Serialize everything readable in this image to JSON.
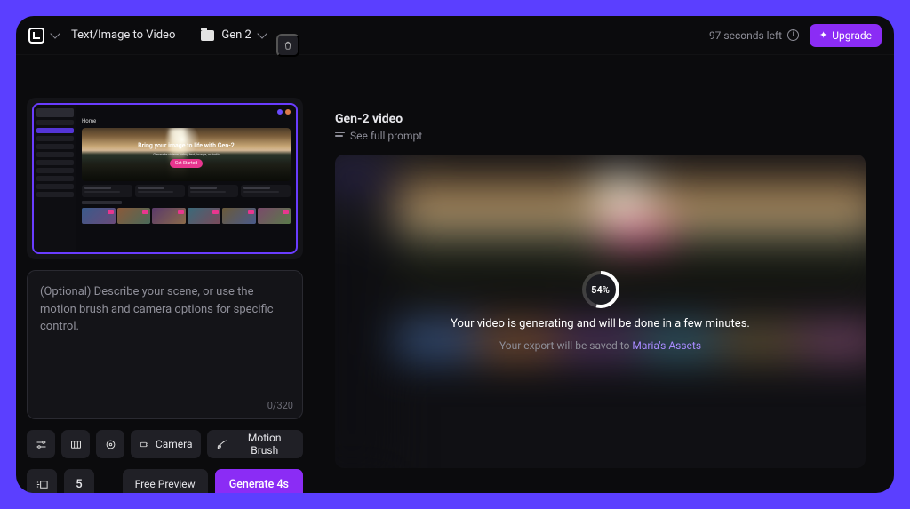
{
  "topbar": {
    "mode_label": "Text/Image to Video",
    "project_name": "Gen 2",
    "seconds_left": "97 seconds left",
    "upgrade_label": "Upgrade"
  },
  "thumbnail": {
    "home_label": "Home",
    "banner_headline": "Bring your image to life with Gen-2",
    "banner_sub": "Generate videos using text, image, or both",
    "cta": "Get Started",
    "chips": [
      "Your tools",
      "Try Gen 1",
      "Try Training",
      "Tell us about yourself"
    ],
    "section_title": "Popular AI Magic Tools"
  },
  "prompt": {
    "placeholder": "(Optional) Describe your scene, or use the motion brush and camera options for specific control.",
    "char_count": "0/320"
  },
  "tools": {
    "camera_label": "Camera",
    "motion_brush_label": "Motion Brush"
  },
  "bottom": {
    "number_value": "5",
    "free_preview_label": "Free Preview",
    "generate_label": "Generate 4s"
  },
  "content": {
    "title": "Gen-2 video",
    "see_prompt_label": "See full prompt",
    "progress_pct": "54%",
    "generating_msg": "Your video is generating and will be done in a few minutes.",
    "save_prefix": "Your export will be saved to ",
    "save_target": "Maria's Assets"
  }
}
